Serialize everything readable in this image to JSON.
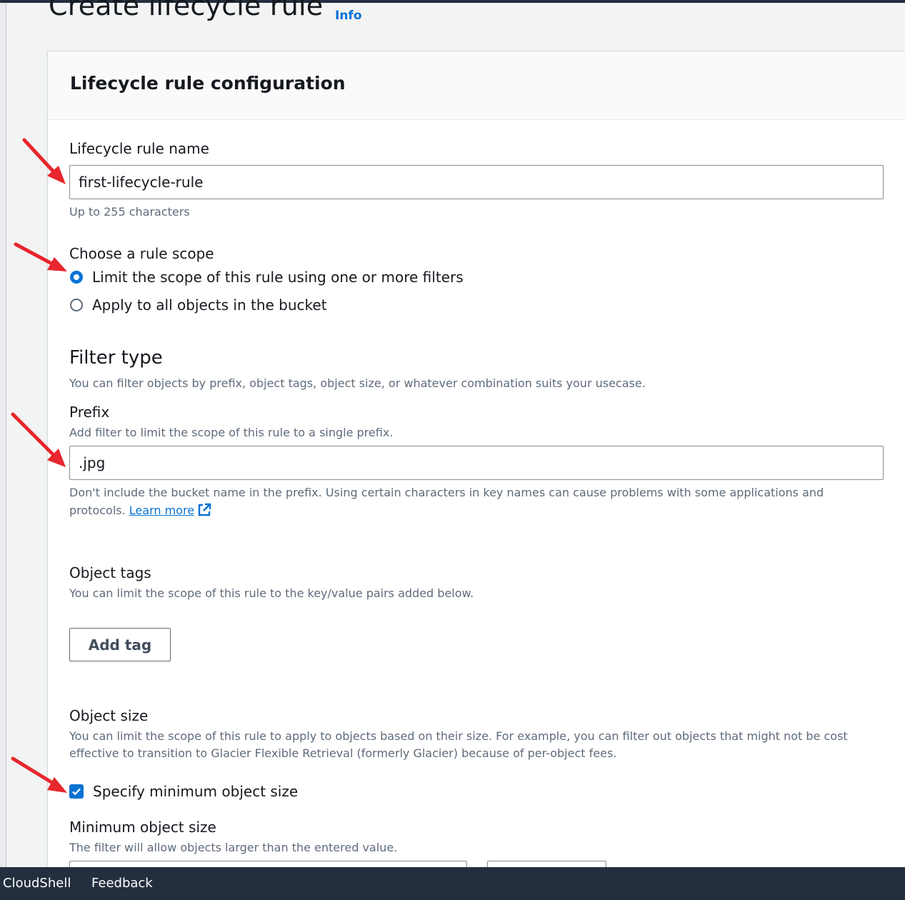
{
  "header": {
    "title": "Create lifecycle rule",
    "info_label": "Info"
  },
  "panel": {
    "title": "Lifecycle rule configuration"
  },
  "rule_name": {
    "label": "Lifecycle rule name",
    "value": "first-lifecycle-rule",
    "constraint": "Up to 255 characters"
  },
  "scope": {
    "label": "Choose a rule scope",
    "options": [
      {
        "label": "Limit the scope of this rule using one or more filters",
        "selected": true
      },
      {
        "label": "Apply to all objects in the bucket",
        "selected": false
      }
    ]
  },
  "filter_type": {
    "heading": "Filter type",
    "description": "You can filter objects by prefix, object tags, object size, or whatever combination suits your usecase."
  },
  "prefix": {
    "label": "Prefix",
    "description": "Add filter to limit the scope of this rule to a single prefix.",
    "value": ".jpg",
    "help_line1": "Don't include the bucket name in the prefix. Using certain characters in key names can cause problems with some applications and",
    "help_line2": "protocols.",
    "learn_more": "Learn more"
  },
  "object_tags": {
    "label": "Object tags",
    "description": "You can limit the scope of this rule to the key/value pairs added below.",
    "add_button": "Add tag"
  },
  "object_size": {
    "label": "Object size",
    "description_line1": "You can limit the scope of this rule to apply to objects based on their size. For example, you can filter out objects that might not be cost",
    "description_line2": "effective to transition to Glacier Flexible Retrieval (formerly Glacier) because of per-object fees.",
    "min_checkbox_label": "Specify minimum object size",
    "min_checked": true,
    "min_label": "Minimum object size",
    "min_description": "The filter will allow objects larger than the entered value."
  },
  "footer": {
    "cloudshell": "CloudShell",
    "feedback": "Feedback"
  },
  "colors": {
    "accent": "#0972d3",
    "annotation_arrow": "#e8262d",
    "footer_bg": "#232f3e"
  }
}
